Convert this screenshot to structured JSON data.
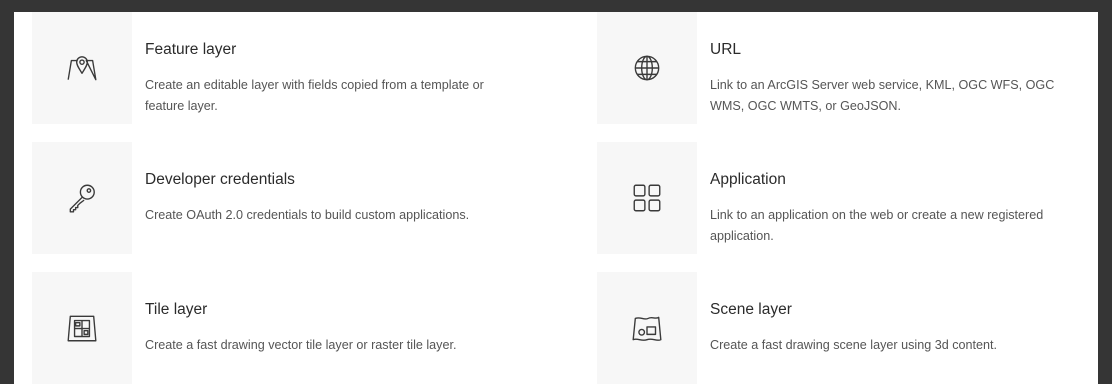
{
  "items": [
    {
      "title": "Feature layer",
      "description": "Create an editable layer with fields copied from a template or feature layer.",
      "icon": "map-pin-icon"
    },
    {
      "title": "URL",
      "description": "Link to an ArcGIS Server web service, KML, OGC WFS, OGC WMS, OGC WMTS, or GeoJSON.",
      "icon": "globe-icon"
    },
    {
      "title": "Developer credentials",
      "description": "Create OAuth 2.0 credentials to build custom applications.",
      "icon": "key-icon"
    },
    {
      "title": "Application",
      "description": "Link to an application on the web or create a new registered application.",
      "icon": "grid-apps-icon"
    },
    {
      "title": "Tile layer",
      "description": "Create a fast drawing vector tile layer or raster tile layer.",
      "icon": "tile-map-icon"
    },
    {
      "title": "Scene layer",
      "description": "Create a fast drawing scene layer using 3d content.",
      "icon": "scene-map-icon"
    }
  ],
  "colors": {
    "background": "#353535",
    "panel": "#ffffff",
    "icon_tile": "#f7f7f7",
    "title_text": "#2b2b2b",
    "description_text": "#555555",
    "icon_stroke": "#3a3a3a"
  }
}
